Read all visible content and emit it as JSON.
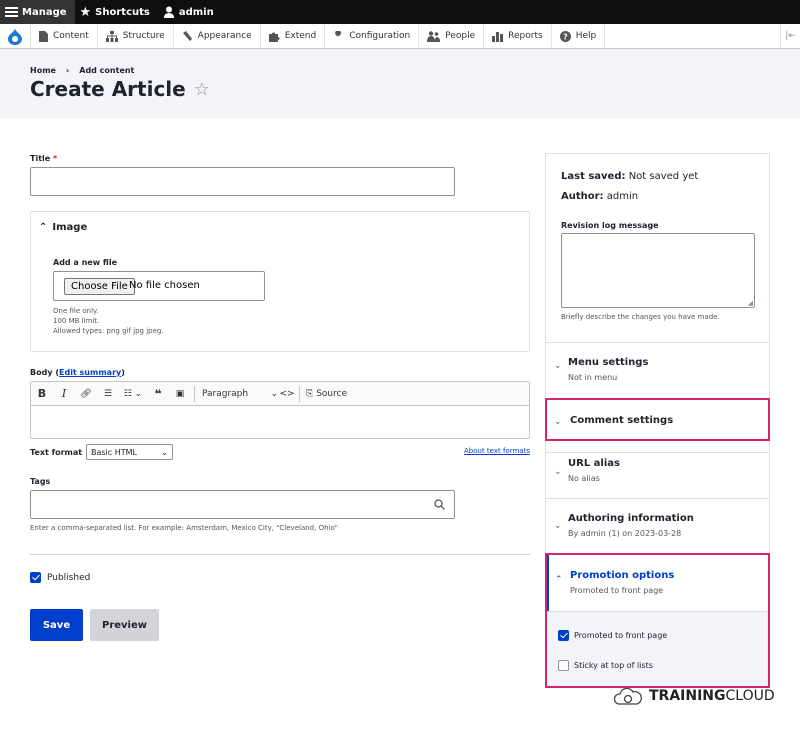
{
  "toolbar": {
    "manage": "Manage",
    "shortcuts": "Shortcuts",
    "user": "admin"
  },
  "tray": [
    "Content",
    "Structure",
    "Appearance",
    "Extend",
    "Configuration",
    "People",
    "Reports",
    "Help"
  ],
  "breadcrumb": {
    "home": "Home",
    "sep": "›",
    "add": "Add content"
  },
  "page_title": "Create Article",
  "form": {
    "title_label": "Title",
    "title_required": "*",
    "image_label": "Image",
    "add_file_label": "Add a new file",
    "choose_file": "Choose File",
    "no_file": "No file chosen",
    "file_help": [
      "One file only.",
      "100 MB limit.",
      "Allowed types: png gif jpg jpeg."
    ],
    "body_label": "Body",
    "edit_summary": "Edit summary",
    "paragraph": "Paragraph",
    "source": "Source",
    "text_format_label": "Text format",
    "text_format_value": "Basic HTML",
    "about_formats": "About text formats",
    "tags_label": "Tags",
    "tags_help": "Enter a comma-separated list. For example: Amsterdam, Mexico City, \"Cleveland, Ohio\"",
    "published": "Published",
    "save": "Save",
    "preview": "Preview"
  },
  "sidebar": {
    "last_saved_label": "Last saved:",
    "last_saved_value": "Not saved yet",
    "author_label": "Author:",
    "author_value": "admin",
    "revision_label": "Revision log message",
    "revision_help": "Briefly describe the changes you have made.",
    "menu_title": "Menu settings",
    "menu_summary": "Not in menu",
    "comment_title": "Comment settings",
    "url_title": "URL alias",
    "url_summary": "No alias",
    "authoring_title": "Authoring information",
    "authoring_summary": "By admin (1) on 2023-03-28",
    "promotion_title": "Promotion options",
    "promotion_summary": "Promoted to front page",
    "promoted_label": "Promoted to front page",
    "sticky_label": "Sticky at top of lists"
  },
  "watermark": {
    "bold": "TRAINING",
    "light": "CLOUD"
  },
  "colors": {
    "accent": "#003ecc",
    "highlight": "#d6246e",
    "header_bg": "#f3f4f9"
  }
}
